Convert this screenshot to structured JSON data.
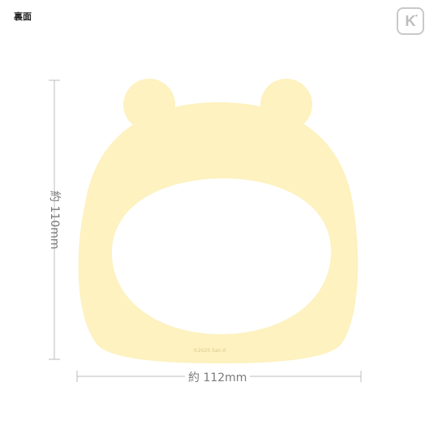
{
  "header": {
    "side_label": "裏面"
  },
  "brand": {
    "icon": "k-logo-icon",
    "letter": "K",
    "mark": "•"
  },
  "product": {
    "color": "#FDF2C0",
    "height_label": "約 110mm",
    "width_label": "約 112mm",
    "copyright": "©2025 San-X"
  },
  "colors": {
    "dimension_line": "#bdbdbd",
    "dimension_text": "#7a7a7a"
  }
}
